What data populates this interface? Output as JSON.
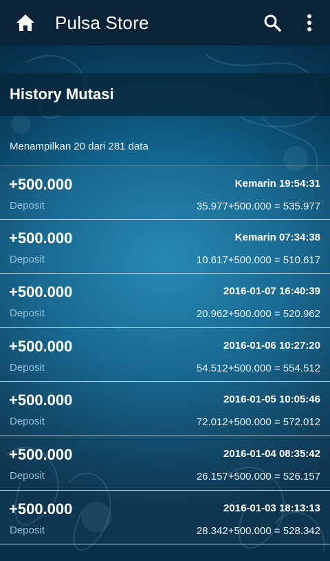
{
  "app": {
    "title": "Pulsa Store",
    "icons": {
      "home": "home-icon",
      "search": "search-icon",
      "more": "more-vert-icon"
    }
  },
  "page": {
    "heading": "History Mutasi",
    "summary": "Menampilkan 20 dari 281 data"
  },
  "colors": {
    "appbar": "#0b2336",
    "background": "#11648e",
    "secondary_text": "#8fc3dc"
  },
  "transactions": [
    {
      "amount": "+500.000",
      "type": "Deposit",
      "time": "Kemarin 19:54:31",
      "calc": "35.977+500.000 = 535.977"
    },
    {
      "amount": "+500.000",
      "type": "Deposit",
      "time": "Kemarin 07:34:38",
      "calc": "10.617+500.000 = 510.617"
    },
    {
      "amount": "+500.000",
      "type": "Deposit",
      "time": "2016-01-07 16:40:39",
      "calc": "20.962+500.000 = 520.962"
    },
    {
      "amount": "+500.000",
      "type": "Deposit",
      "time": "2016-01-06 10:27:20",
      "calc": "54.512+500.000 = 554.512"
    },
    {
      "amount": "+500.000",
      "type": "Deposit",
      "time": "2016-01-05 10:05:46",
      "calc": "72.012+500.000 = 572.012"
    },
    {
      "amount": "+500.000",
      "type": "Deposit",
      "time": "2016-01-04 08:35:42",
      "calc": "26.157+500.000 = 526.157"
    },
    {
      "amount": "+500.000",
      "type": "Deposit",
      "time": "2016-01-03 18:13:13",
      "calc": "28.342+500.000 = 528.342"
    }
  ]
}
